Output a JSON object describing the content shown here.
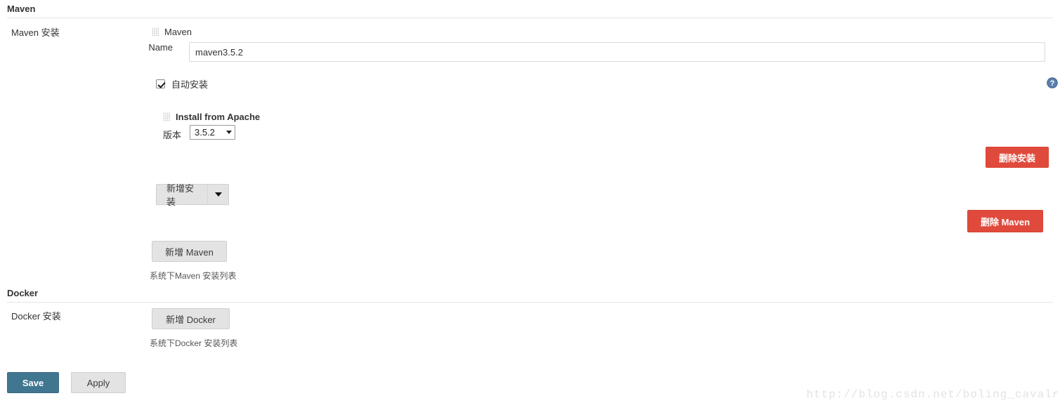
{
  "sections": {
    "maven": {
      "header": "Maven",
      "row_label": "Maven 安装",
      "tool_title": "Maven",
      "name_label": "Name",
      "name_value": "maven3.5.2",
      "auto_install_label": "自动安装",
      "installer_title": "Install from Apache",
      "version_label": "版本",
      "version_value": "3.5.2",
      "delete_installer_button": "删除安装",
      "add_installer_button": "新增安装",
      "delete_tool_button": "删除 Maven",
      "add_tool_button": "新增 Maven",
      "helper_text": "系统下Maven 安装列表"
    },
    "docker": {
      "header": "Docker",
      "row_label": "Docker 安装",
      "add_tool_button": "新增 Docker",
      "helper_text": "系统下Docker 安装列表"
    }
  },
  "footer": {
    "save_button": "Save",
    "apply_button": "Apply"
  },
  "watermark": "http://blog.csdn.net/boling_cavalry",
  "icons": {
    "help": "help-circle-icon",
    "drag_grip": "drag-grip-icon"
  },
  "colors": {
    "danger": "#e04a3c",
    "primary": "#417690",
    "button_grey": "#e3e3e3",
    "help_blue": "#5a7fad"
  }
}
